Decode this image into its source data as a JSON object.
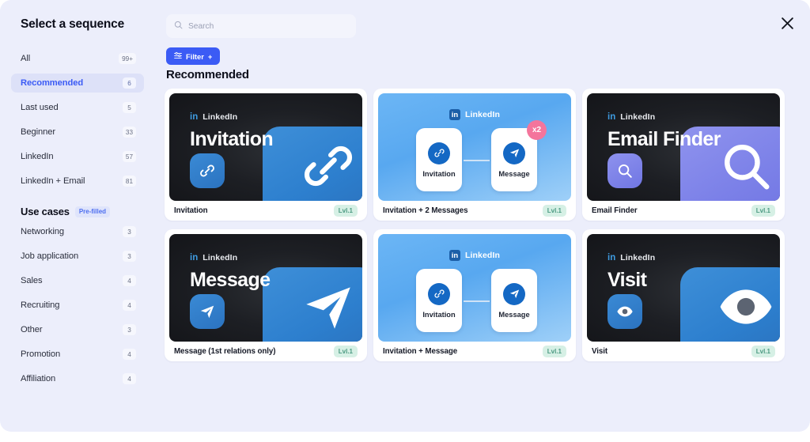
{
  "sidebar": {
    "title": "Select a sequence",
    "nav": [
      {
        "label": "All",
        "count": "99+",
        "active": false
      },
      {
        "label": "Recommended",
        "count": "6",
        "active": true
      },
      {
        "label": "Last used",
        "count": "5",
        "active": false
      },
      {
        "label": "Beginner",
        "count": "33",
        "active": false
      },
      {
        "label": "LinkedIn",
        "count": "57",
        "active": false
      },
      {
        "label": "LinkedIn + Email",
        "count": "81",
        "active": false
      }
    ],
    "usecases_title": "Use cases",
    "usecases_badge": "Pre-filled",
    "usecases": [
      {
        "label": "Networking",
        "count": "3"
      },
      {
        "label": "Job application",
        "count": "3"
      },
      {
        "label": "Sales",
        "count": "4"
      },
      {
        "label": "Recruiting",
        "count": "4"
      },
      {
        "label": "Other",
        "count": "3"
      },
      {
        "label": "Promotion",
        "count": "4"
      },
      {
        "label": "Affiliation",
        "count": "4"
      }
    ]
  },
  "main": {
    "search_placeholder": "Search",
    "search_value": "",
    "filter_label": "Filter",
    "filter_plus": "+",
    "section_title": "Recommended",
    "close_label": "×"
  },
  "cards": [
    {
      "name": "Invitation",
      "level": "Lvl.1",
      "style": "dark",
      "accent": "blue",
      "provider": "LinkedIn",
      "provider_mark": "in",
      "art_title": "Invitation",
      "icon": "link-icon"
    },
    {
      "name": "Invitation + 2 Messages",
      "level": "Lvl.1",
      "style": "blue",
      "provider": "LinkedIn",
      "provider_mark": "in",
      "nodes": [
        {
          "label": "Invitation",
          "icon": "link-icon"
        },
        {
          "label": "Message",
          "icon": "send-icon"
        }
      ],
      "multiplier": "x2"
    },
    {
      "name": "Email Finder",
      "level": "Lvl.1",
      "style": "dark",
      "accent": "violet",
      "provider": "LinkedIn",
      "provider_mark": "in",
      "art_title": "Email Finder",
      "icon": "search-icon"
    },
    {
      "name": "Message (1st relations only)",
      "level": "Lvl.1",
      "style": "dark",
      "accent": "blue",
      "provider": "LinkedIn",
      "provider_mark": "in",
      "art_title": "Message",
      "icon": "send-icon"
    },
    {
      "name": "Invitation + Message",
      "level": "Lvl.1",
      "style": "blue",
      "provider": "LinkedIn",
      "provider_mark": "in",
      "nodes": [
        {
          "label": "Invitation",
          "icon": "link-icon"
        },
        {
          "label": "Message",
          "icon": "send-icon"
        }
      ]
    },
    {
      "name": "Visit",
      "level": "Lvl.1",
      "style": "dark",
      "accent": "blue",
      "provider": "LinkedIn",
      "provider_mark": "in",
      "art_title": "Visit",
      "icon": "eye-icon"
    }
  ],
  "colors": {
    "accent": "#3b5bf5",
    "page_bg": "#eceefb",
    "level_badge": "#d6f0e5",
    "multiplier_badge": "#f4759c"
  }
}
